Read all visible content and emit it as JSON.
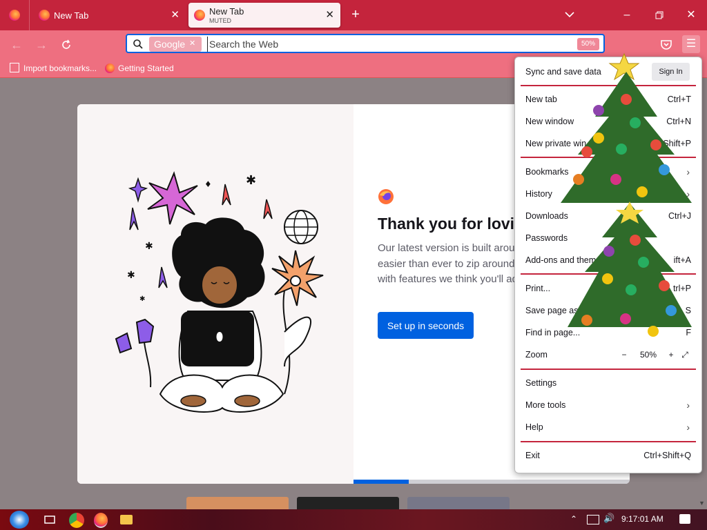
{
  "browser": {
    "tabs": [
      {
        "title": "New Tab",
        "subtitle": ""
      },
      {
        "title": "New Tab",
        "subtitle": "MUTED"
      }
    ],
    "urlbar": {
      "engine": "Google",
      "placeholder": "Search the Web",
      "zoom": "50%"
    },
    "bookmarks": [
      {
        "label": "Import bookmarks..."
      },
      {
        "label": "Getting Started"
      }
    ]
  },
  "welcome": {
    "title": "Thank you for lovin",
    "body_lines": [
      "Our latest version is built arour",
      "easier than ever to zip around f",
      "with features we think you'll ad"
    ],
    "cta": "Set up in seconds",
    "progress": 0.2
  },
  "app_menu": {
    "sync_label": "Sync and save data",
    "signin_label": "Sign In",
    "items": [
      {
        "label": "New tab",
        "shortcut": "Ctrl+T"
      },
      {
        "label": "New window",
        "shortcut": "Ctrl+N"
      },
      {
        "label": "New private win",
        "shortcut": "Shift+P"
      },
      {
        "label": "Bookmarks",
        "shortcut": ""
      },
      {
        "label": "History",
        "shortcut": ""
      },
      {
        "label": "Downloads",
        "shortcut": "Ctrl+J"
      },
      {
        "label": "Passwords",
        "shortcut": ""
      },
      {
        "label": "Add-ons and themes",
        "shortcut": "ift+A"
      },
      {
        "label": "Print...",
        "shortcut": "trl+P"
      },
      {
        "label": "Save page as...",
        "shortcut": "S"
      },
      {
        "label": "Find in page...",
        "shortcut": "F"
      },
      {
        "label": "Zoom",
        "shortcut": ""
      },
      {
        "label": "Settings",
        "shortcut": ""
      },
      {
        "label": "More tools",
        "shortcut": ""
      },
      {
        "label": "Help",
        "shortcut": ""
      },
      {
        "label": "Exit",
        "shortcut": "Ctrl+Shift+Q"
      }
    ],
    "zoom": {
      "minus": "−",
      "value": "50%",
      "plus": "+"
    }
  },
  "taskbar": {
    "time": "9:17:01 AM"
  },
  "colors": {
    "titlebar": "#c4243c",
    "navbar": "#ee6f80",
    "accent": "#0061e0"
  }
}
